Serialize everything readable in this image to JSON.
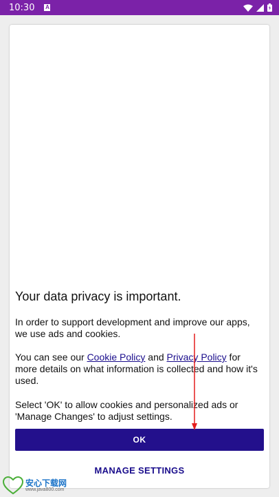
{
  "status_bar": {
    "time": "10:30",
    "notification_glyph": "A",
    "icons": [
      "wifi-icon",
      "signal-icon",
      "battery-icon"
    ],
    "background": "#7b22a8"
  },
  "dialog": {
    "title": "Your data privacy is important.",
    "paragraph1": "In order to support development and improve our apps, we use ads and cookies.",
    "paragraph2_prefix": "You can see our ",
    "cookie_link": "Cookie Policy",
    "paragraph2_and": " and ",
    "privacy_link": "Privacy Policy",
    "paragraph2_suffix": " for more details on what information is collected and how it's used.",
    "paragraph3": "Select 'OK' to allow cookies and personalized ads or 'Manage Changes' to adjust settings.",
    "ok_label": "OK",
    "manage_label": "MANAGE SETTINGS",
    "accent_color": "#23108c"
  },
  "watermark": {
    "brand": "安心下载网",
    "url": "www.java800.com"
  }
}
